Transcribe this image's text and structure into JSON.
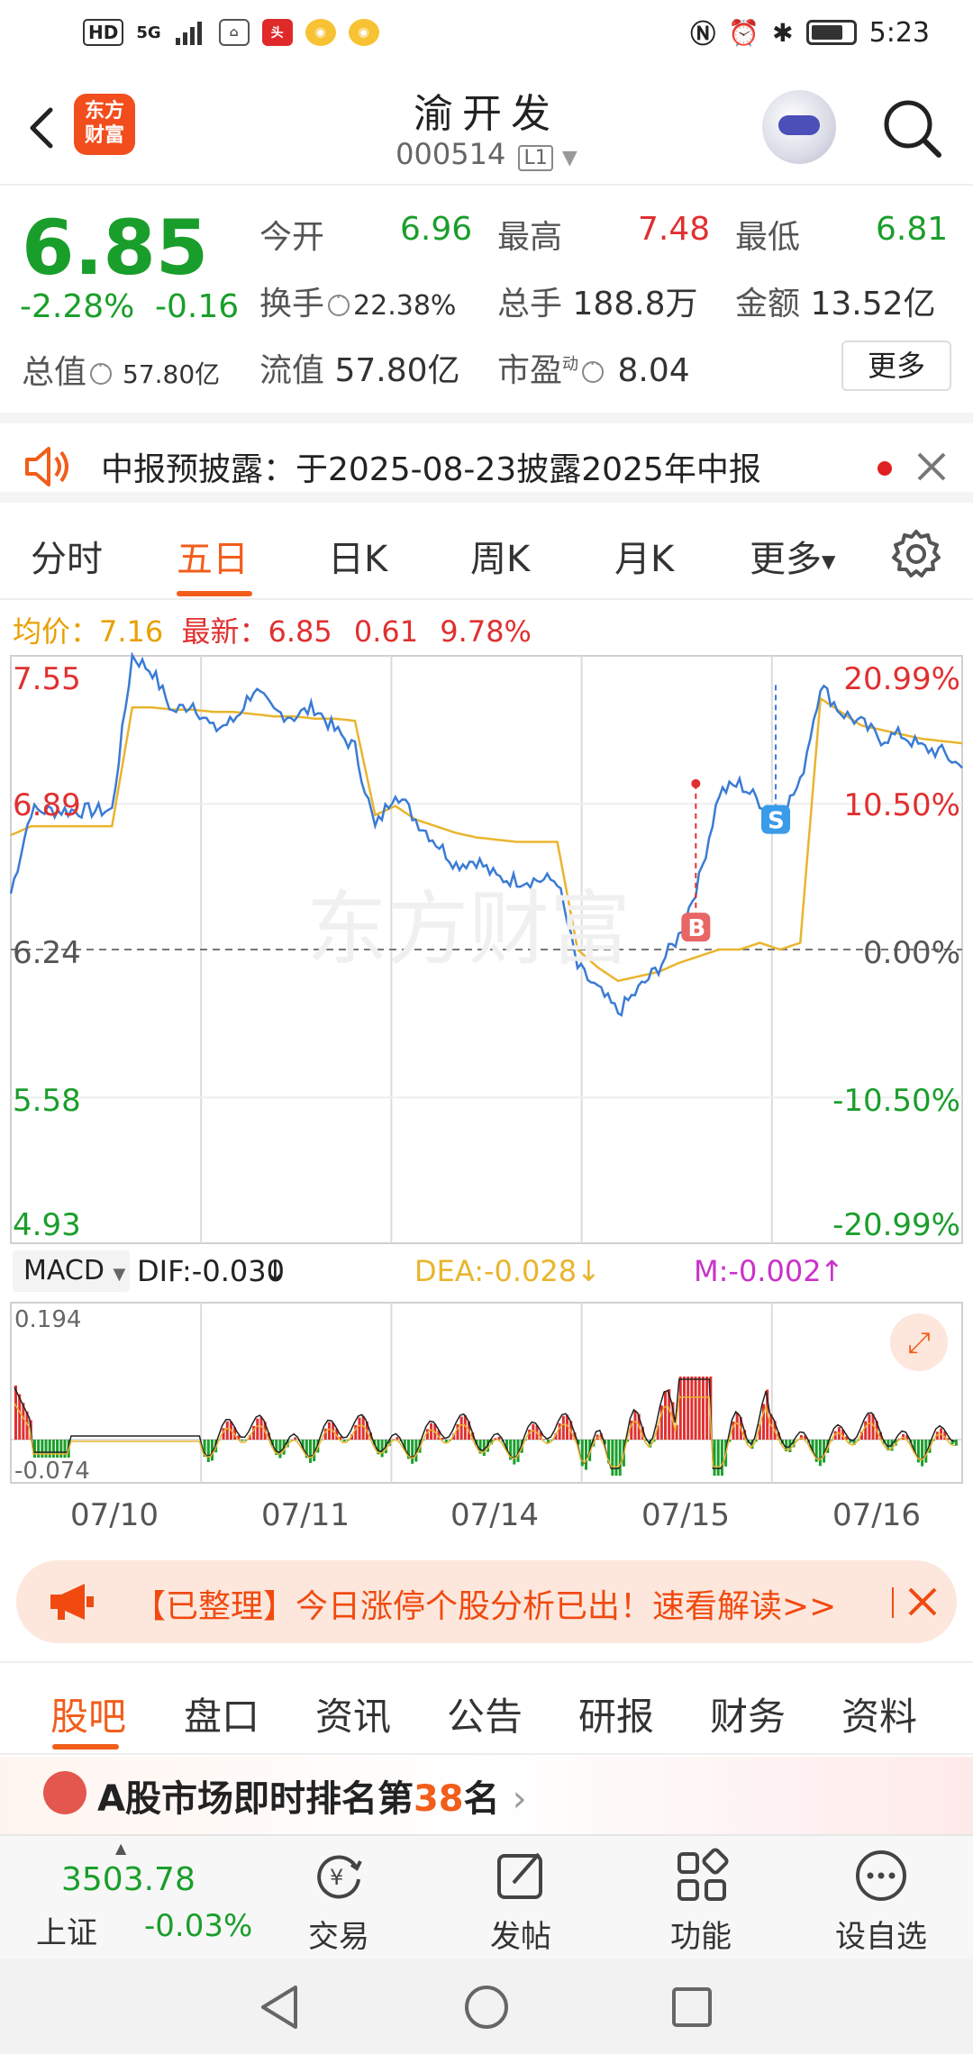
{
  "status_bar": {
    "hd": "HD",
    "network": "5G",
    "time": "5:23"
  },
  "header": {
    "back_icon": "back-arrow-icon",
    "logo_line1": "东方",
    "logo_line2": "财富",
    "title": "渝开发",
    "code": "000514",
    "level": "L1"
  },
  "quote": {
    "price": "6.85",
    "change_pct": "-2.28%",
    "change": "-0.16",
    "total_value_label": "总值",
    "total_value": "57.80亿",
    "open_label": "今开",
    "open": "6.96",
    "high_label": "最高",
    "high": "7.48",
    "low_label": "最低",
    "low": "6.81",
    "turnover_label": "换手",
    "turnover": "22.38%",
    "volume_label": "总手",
    "volume": "188.8万",
    "amount_label": "金额",
    "amount": "13.52亿",
    "float_label": "流值",
    "float_value": "57.80亿",
    "pe_label": "市盈",
    "pe_sup": "动",
    "pe": "8.04",
    "more_label": "更多"
  },
  "notice": {
    "text": "中报预披露：于2025-08-23披露2025年中报"
  },
  "chart_tabs": {
    "items": [
      "分时",
      "五日",
      "日K",
      "周K",
      "月K",
      "更多"
    ],
    "active": "五日"
  },
  "info_line": {
    "avg_label": "均价：",
    "avg": "7.16",
    "latest_label": "最新：",
    "latest": "6.85",
    "change": "0.61",
    "change_pct": "9.78%"
  },
  "chart_data": {
    "type": "line",
    "title": "",
    "y_axis_left": [
      "7.55",
      "6.89",
      "6.24",
      "5.58",
      "4.93"
    ],
    "y_axis_right": [
      "20.99%",
      "10.50%",
      "0.00%",
      "-10.50%",
      "-20.99%"
    ],
    "ylim": [
      4.93,
      7.55
    ],
    "prev_close": 6.24,
    "x_days": [
      "07/10",
      "07/11",
      "07/14",
      "07/15",
      "07/16"
    ],
    "series": [
      {
        "values": [
          6.49,
          6.86,
          6.86,
          6.86,
          6.86,
          6.86,
          7.55,
          7.48,
          7.3,
          7.34,
          7.22,
          7.26,
          7.4,
          7.3,
          7.28,
          7.32,
          7.22,
          7.14,
          6.78,
          6.95,
          6.82,
          6.72,
          6.62,
          6.64,
          6.56,
          6.55,
          6.55,
          6.55,
          6.16,
          6.06,
          5.96,
          6.06,
          6.16,
          6.3,
          6.55,
          6.94,
          6.98,
          6.9,
          6.84,
          6.98,
          7.42,
          7.3,
          7.25,
          7.18,
          7.2,
          7.14,
          7.12,
          7.05
        ]
      },
      {
        "values": [
          6.75,
          6.79,
          6.79,
          6.79,
          6.79,
          6.79,
          7.32,
          7.32,
          7.31,
          7.31,
          7.3,
          7.3,
          7.29,
          7.28,
          7.28,
          7.27,
          7.27,
          7.26,
          6.84,
          6.88,
          6.82,
          6.79,
          6.76,
          6.74,
          6.73,
          6.72,
          6.72,
          6.72,
          6.24,
          6.16,
          6.1,
          6.12,
          6.14,
          6.18,
          6.21,
          6.24,
          6.24,
          6.27,
          6.24,
          6.27,
          7.36,
          7.3,
          7.24,
          7.22,
          7.2,
          7.18,
          7.17,
          7.16
        ]
      }
    ],
    "macd": {
      "dif": "-0.030",
      "dea": "-0.028",
      "m": "-0.002",
      "top": "0.194",
      "bottom": "-0.074"
    },
    "markers": [
      {
        "label": "B"
      },
      {
        "label": "S"
      }
    ],
    "grid": true
  },
  "macd_header": {
    "button": "MACD",
    "dif": "DIF:-0.030",
    "dea": "DEA:-0.028",
    "m": "M:-0.002"
  },
  "banner": {
    "text": "【已整理】今日涨停个股分析已出！速看解读>>"
  },
  "bottom_tabs": {
    "items": [
      "股吧",
      "盘口",
      "资讯",
      "公告",
      "研报",
      "财务",
      "资料"
    ],
    "active": "股吧"
  },
  "ranking": {
    "prefix": "A股市场即时排名第",
    "rank": "38",
    "suffix": "名"
  },
  "bottom_bar": {
    "index_value": "3503.78",
    "index_name": "上证",
    "index_change": "-0.03%",
    "items": [
      "交易",
      "发帖",
      "功能",
      "设自选"
    ]
  },
  "colors": {
    "up": "#e03030",
    "down": "#1a9e2b",
    "accent": "#f25d1a",
    "price_line": "#3a7bd5",
    "avg_line": "#e9b52e"
  }
}
